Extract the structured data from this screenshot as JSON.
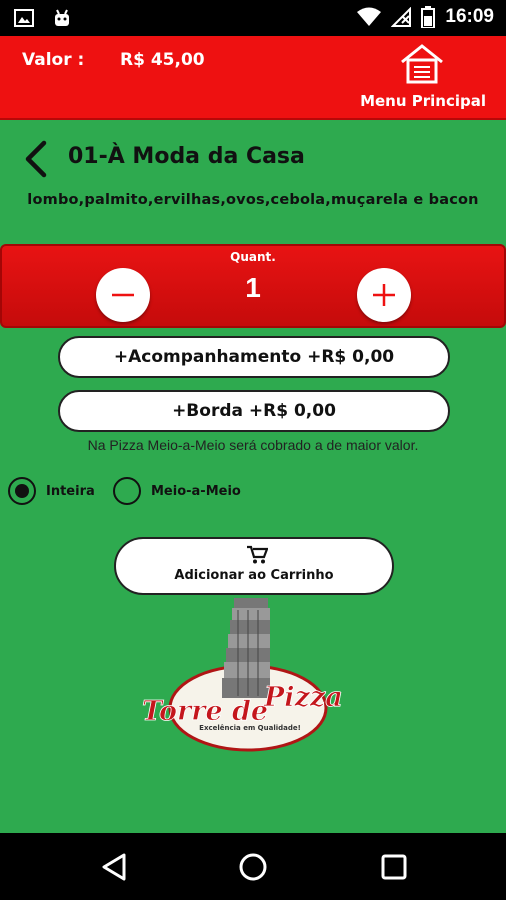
{
  "status_bar": {
    "time": "16:09",
    "icons": [
      "image-icon",
      "android-icon",
      "wifi-icon",
      "signal-icon",
      "battery-icon"
    ]
  },
  "header": {
    "valor_label": "Valor :",
    "valor_amount": "R$ 45,00",
    "menu_label": "Menu Principal",
    "background_color": "#ee1111"
  },
  "product": {
    "title": "01-À Moda da Casa",
    "ingredients": "lombo,palmito,ervilhas,ovos,cebola,muçarela e bacon"
  },
  "quantity": {
    "label": "Quant.",
    "value": "1"
  },
  "options": {
    "acompanhamento": "+Acompanhamento +R$ 0,00",
    "borda": "+Borda +R$ 0,00",
    "note": "Na Pizza Meio-a-Meio será cobrado a de maior valor."
  },
  "pizza_type": {
    "inteira": "Inteira",
    "meio": "Meio-a-Meio",
    "selected": "Inteira"
  },
  "cart": {
    "label": "Adicionar ao Carrinho"
  },
  "logo": {
    "name": "Torre de Pizza",
    "tagline": "Excelência em Qualidade!"
  },
  "theme": {
    "background": "#2eaa4f",
    "accent": "#ee1111"
  }
}
